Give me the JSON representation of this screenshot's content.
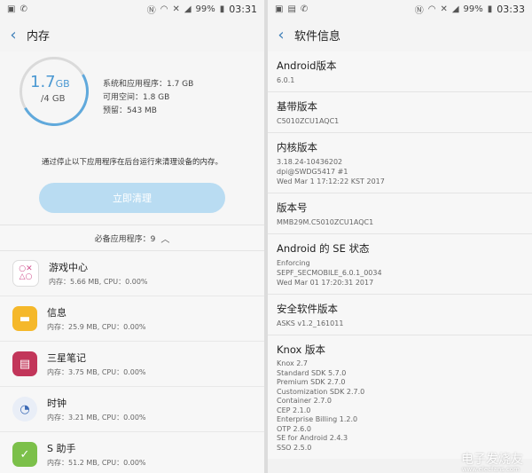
{
  "left": {
    "status": {
      "battery": "99%",
      "time": "03:31"
    },
    "header": {
      "title": "内存"
    },
    "memory": {
      "used": "1.7",
      "used_unit": "GB",
      "total": "/4 GB",
      "system_apps": "系统和应用程序：1.7 GB",
      "available": "可用空间：1.8 GB",
      "reserved": "预留：543 MB",
      "note": "通过停止以下应用程序在后台运行来清理设备的内存。",
      "clean_button": "立即清理"
    },
    "essential": "必备应用程序：9",
    "apps": [
      {
        "name": "游戏中心",
        "usage": "内存：5.66 MB, CPU：0.00%"
      },
      {
        "name": "信息",
        "usage": "内存：25.9 MB, CPU：0.00%"
      },
      {
        "name": "三星笔记",
        "usage": "内存：3.75 MB, CPU：0.00%"
      },
      {
        "name": "时钟",
        "usage": "内存：3.21 MB, CPU：0.00%"
      },
      {
        "name": "S 助手",
        "usage": "内存：51.2 MB, CPU：0.00%"
      }
    ]
  },
  "right": {
    "status": {
      "battery": "99%",
      "time": "03:33"
    },
    "header": {
      "title": "软件信息"
    },
    "items": [
      {
        "label": "Android版本",
        "value": "6.0.1"
      },
      {
        "label": "基带版本",
        "value": "C5010ZCU1AQC1"
      },
      {
        "label": "内核版本",
        "value": "3.18.24-10436202\ndpi@SWDG5417 #1\nWed Mar 1 17:12:22 KST 2017"
      },
      {
        "label": "版本号",
        "value": "MMB29M.C5010ZCU1AQC1"
      },
      {
        "label": "Android 的 SE 状态",
        "value": "Enforcing\nSEPF_SECMOBILE_6.0.1_0034\nWed Mar 01 17:20:31 2017"
      },
      {
        "label": "安全软件版本",
        "value": "ASKS v1.2_161011"
      },
      {
        "label": "Knox 版本",
        "value": "Knox 2.7\nStandard SDK 5.7.0\nPremium SDK 2.7.0\nCustomization SDK 2.7.0\nContainer 2.7.0\nCEP 2.1.0\nEnterprise Billing 1.2.0\nOTP 2.6.0\nSE for Android 2.4.3\nSSO 2.5.0"
      }
    ]
  },
  "watermark": {
    "text": "电子发烧友",
    "sub": "www.elecfans.com"
  },
  "colors": {
    "accent": "#4a98d2",
    "button": "#b9dcf2"
  }
}
